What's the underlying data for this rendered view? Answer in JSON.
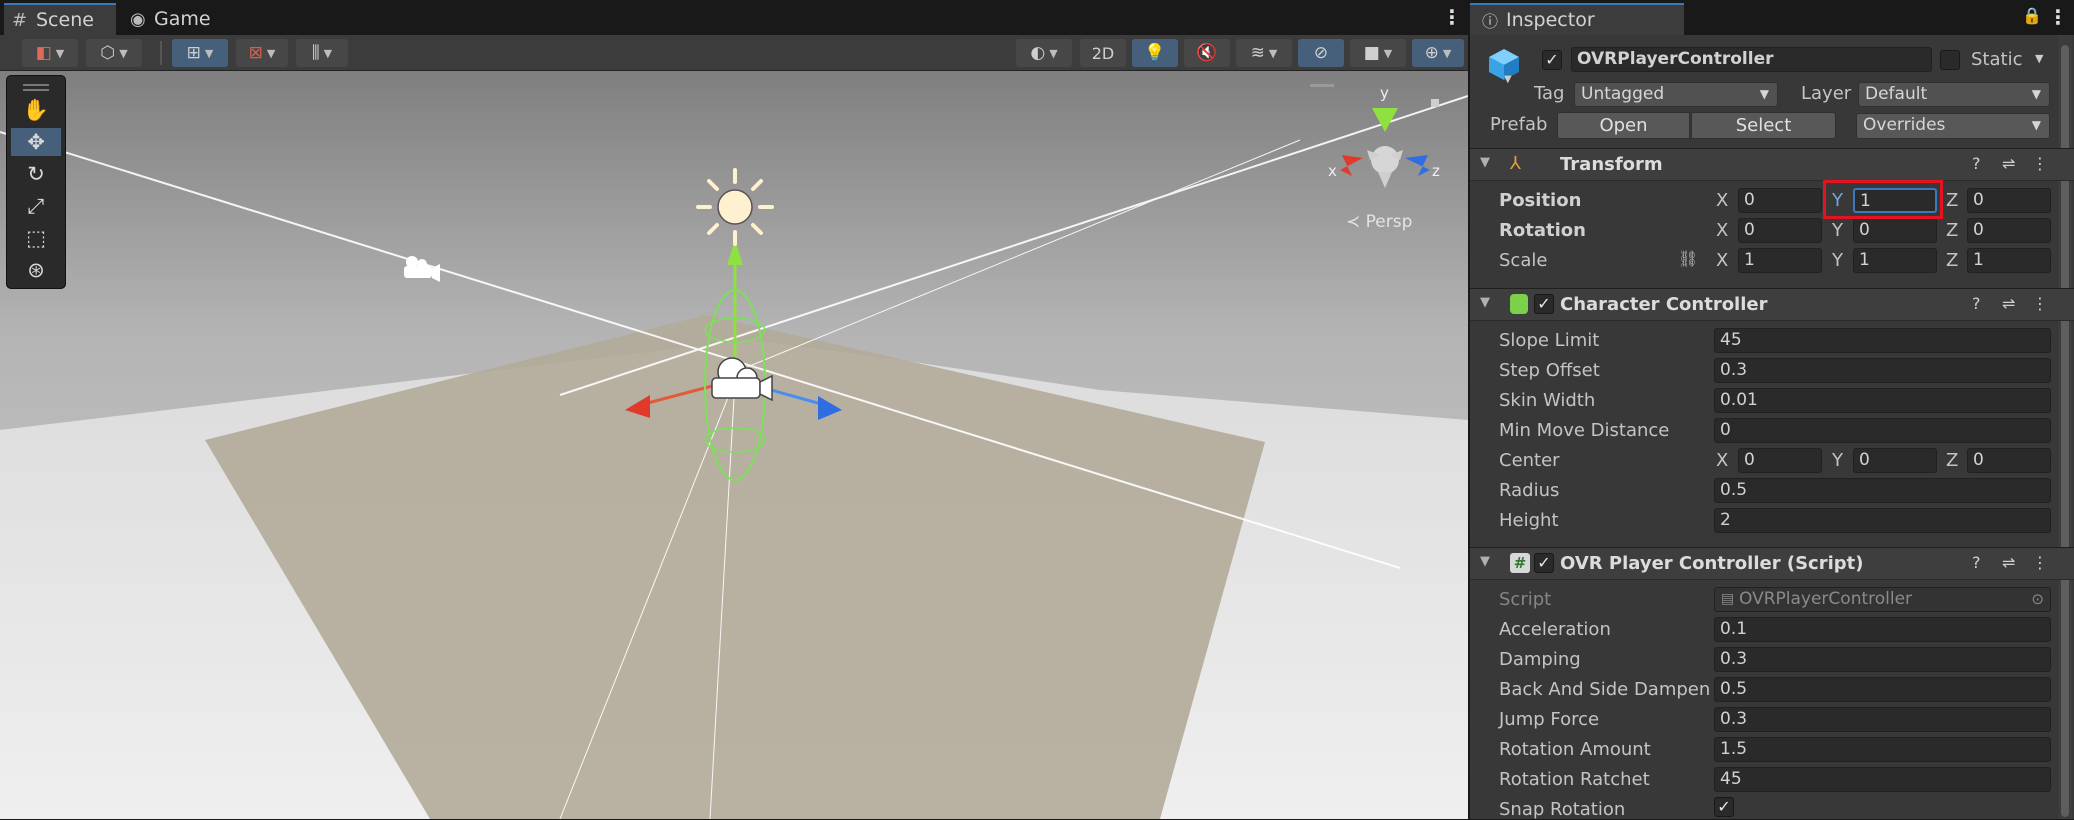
{
  "scene_panel": {
    "tabs": [
      {
        "label": "Scene",
        "icon": "grid-icon"
      },
      {
        "label": "Game",
        "icon": "gamepad-icon"
      }
    ],
    "toolbar": {
      "mode_2d_label": "2D"
    },
    "viewport": {
      "projection_label": "Persp",
      "gizmo_axes": {
        "x": "x",
        "y": "y",
        "z": "z"
      }
    }
  },
  "inspector": {
    "tab_label": "Inspector",
    "object": {
      "name": "OVRPlayerController",
      "active": true,
      "static_label": "Static"
    },
    "tag": {
      "label": "Tag",
      "value": "Untagged"
    },
    "layer": {
      "label": "Layer",
      "value": "Default"
    },
    "prefab": {
      "label": "Prefab",
      "open_label": "Open",
      "select_label": "Select",
      "overrides_label": "Overrides"
    },
    "transform": {
      "title": "Transform",
      "position": {
        "label": "Position",
        "x": "0",
        "y": "1",
        "z": "0"
      },
      "rotation": {
        "label": "Rotation",
        "x": "0",
        "y": "0",
        "z": "0"
      },
      "scale": {
        "label": "Scale",
        "x": "1",
        "y": "1",
        "z": "1"
      },
      "axis_labels": {
        "x": "X",
        "y": "Y",
        "z": "Z"
      }
    },
    "character_controller": {
      "title": "Character Controller",
      "slope_limit": {
        "label": "Slope Limit",
        "value": "45"
      },
      "step_offset": {
        "label": "Step Offset",
        "value": "0.3"
      },
      "skin_width": {
        "label": "Skin Width",
        "value": "0.01"
      },
      "min_move_distance": {
        "label": "Min Move Distance",
        "value": "0"
      },
      "center": {
        "label": "Center",
        "x": "0",
        "y": "0",
        "z": "0"
      },
      "radius": {
        "label": "Radius",
        "value": "0.5"
      },
      "height": {
        "label": "Height",
        "value": "2"
      }
    },
    "ovr_script": {
      "title": "OVR Player Controller (Script)",
      "script": {
        "label": "Script",
        "value": "OVRPlayerController"
      },
      "acceleration": {
        "label": "Acceleration",
        "value": "0.1"
      },
      "damping": {
        "label": "Damping",
        "value": "0.3"
      },
      "back_and_side_dampen": {
        "label": "Back And Side Dampen",
        "value": "0.5"
      },
      "jump_force": {
        "label": "Jump Force",
        "value": "0.3"
      },
      "rotation_amount": {
        "label": "Rotation Amount",
        "value": "1.5"
      },
      "rotation_ratchet": {
        "label": "Rotation Ratchet",
        "value": "45"
      },
      "snap_rotation": {
        "label": "Snap Rotation",
        "checked": true
      }
    }
  }
}
